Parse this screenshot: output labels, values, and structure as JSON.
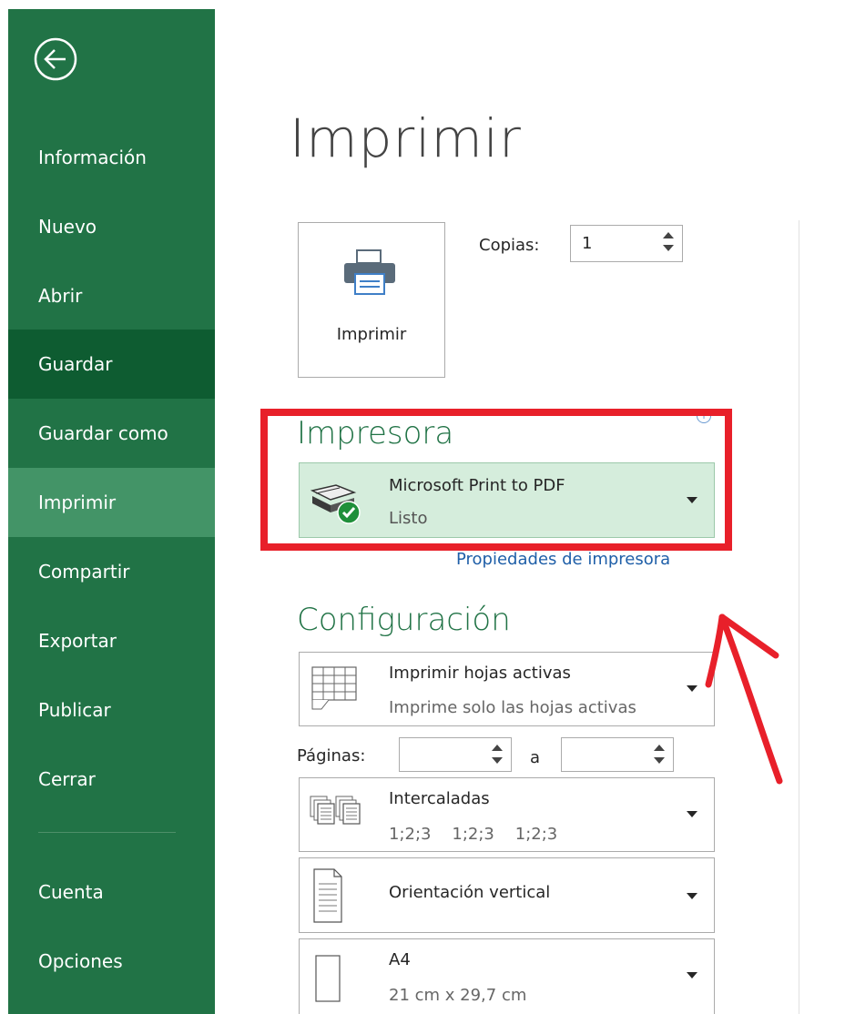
{
  "sidebar": {
    "items": [
      {
        "label": "Información"
      },
      {
        "label": "Nuevo"
      },
      {
        "label": "Abrir"
      },
      {
        "label": "Guardar"
      },
      {
        "label": "Guardar como"
      },
      {
        "label": "Imprimir"
      },
      {
        "label": "Compartir"
      },
      {
        "label": "Exportar"
      },
      {
        "label": "Publicar"
      },
      {
        "label": "Cerrar"
      },
      {
        "label": "Cuenta"
      },
      {
        "label": "Opciones"
      }
    ],
    "active": "Imprimir"
  },
  "main": {
    "title": "Imprimir",
    "print_button_label": "Imprimir",
    "copies_label": "Copias:",
    "copies_value": "1",
    "printer": {
      "heading": "Impresora",
      "name": "Microsoft Print to PDF",
      "status": "Listo",
      "properties_link": "Propiedades de impresora",
      "info_glyph": "i"
    },
    "settings": {
      "heading": "Configuración",
      "sheets": {
        "title": "Imprimir hojas activas",
        "subtitle": "Imprime solo las hojas activas"
      },
      "pages_label": "Páginas:",
      "pages_to_label": "a",
      "pages_from": "",
      "pages_to": "",
      "collate": {
        "title": "Intercaladas",
        "subtitle": "1;2;3    1;2;3    1;2;3"
      },
      "orientation": {
        "title": "Orientación vertical"
      },
      "paper": {
        "title": "A4",
        "subtitle": "21 cm x 29,7 cm"
      }
    }
  },
  "colors": {
    "sidebar": "#217346",
    "sidebar_active": "#439467",
    "sidebar_saved": "#0e5c31",
    "accent_green": "#217346",
    "printer_dropdown": "#d5eddc",
    "annotation_red": "#e8202a"
  },
  "icons": [
    "back-arrow-icon",
    "printer-icon",
    "pdf-printer-ready-icon",
    "sheet-grid-icon",
    "collate-pages-icon",
    "portrait-document-icon",
    "paper-size-icon",
    "info-icon"
  ]
}
